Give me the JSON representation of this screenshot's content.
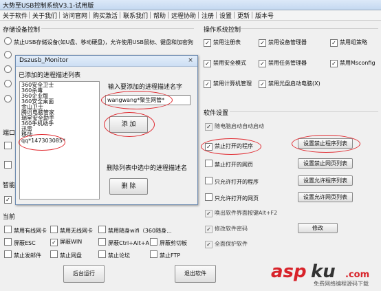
{
  "window": {
    "title": "大势至USB控制系统V3.1-试用版"
  },
  "menu": [
    "关于软件",
    "关于我们",
    "访问官网",
    "购买激活",
    "联系我们",
    "帮助",
    "远程协助",
    "注册",
    "设置",
    "更新",
    "版本号"
  ],
  "left_panel": {
    "storage_title": "存储设备控制",
    "storage_option_text": "禁止USB存储设备(如U盘、移动硬盘)，允许使用USB鼠标、键盘和加密狗",
    "row_labels": {
      "port": "端口",
      "smart": "智能",
      "current": "当前"
    }
  },
  "bottom_checks": [
    [
      "禁用有线网卡",
      "禁用无线网卡",
      "禁用随身wifi（360随身..."
    ],
    [
      "屏蔽ESC",
      "屏蔽WIN",
      "屏蔽Ctrl+Alt+A",
      "屏蔽剪切板"
    ],
    [
      "禁止发邮件",
      "禁止网盘",
      "禁止论坛",
      "禁止FTP"
    ]
  ],
  "bottom_buttons": {
    "background": "后台运行",
    "exit": "退出软件"
  },
  "os_panel": {
    "title": "操作系统控制",
    "checks": [
      [
        "禁用注册表",
        "禁用设备管理器",
        "禁用组策略"
      ],
      [
        "禁用安全模式",
        "禁用任务管理器",
        "禁用Msconfig"
      ],
      [
        "禁用计算机管理",
        "禁用光盘启动电脑(X)"
      ]
    ]
  },
  "soft_panel": {
    "title": "软件设置",
    "rows": [
      {
        "label": "随电脑启动自动启动",
        "button": ""
      },
      {
        "label": "禁止打开的程序",
        "button": "设置禁止程序列表"
      },
      {
        "label": "禁止打开的网页",
        "button": "设置禁止网页列表"
      },
      {
        "label": "只允许打开的程序",
        "button": "设置允许程序列表"
      },
      {
        "label": "只允许打开的网页",
        "button": "设置允许网页列表"
      },
      {
        "label": "唤出软件界面按键Alt+F2",
        "button": ""
      },
      {
        "label": "修改软件密码",
        "button": "修改"
      },
      {
        "label": "全面保护软件",
        "button": ""
      }
    ]
  },
  "dialog": {
    "title": "Dszusb_Monitor",
    "close": "×",
    "list_label": "已添加的进程描述列表",
    "list_items": [
      "360安全卫士",
      "360杀毒",
      "360企业版",
      "360安全桌面",
      "金山卫士",
      "腾讯电脑管家",
      "瑞星安全助手",
      "360手机助手",
      "迅雷",
      "移动",
      "qq*147303085*"
    ],
    "input_label": "输入要添加的进程描述名字",
    "input_value": "wangwang*聚生网管*",
    "add_button": "添 加",
    "delete_label": "删除列表中选中的进程描述名",
    "delete_button": "删 除"
  },
  "watermark": {
    "brand_a": "asp",
    "brand_b": "ku",
    ".com": ".com",
    "tagline": "免费网络编程源码下载"
  },
  "colors": {
    "annotation": "#e0282e",
    "watermark_red": "#d8232a",
    "watermark_dark": "#333333"
  }
}
